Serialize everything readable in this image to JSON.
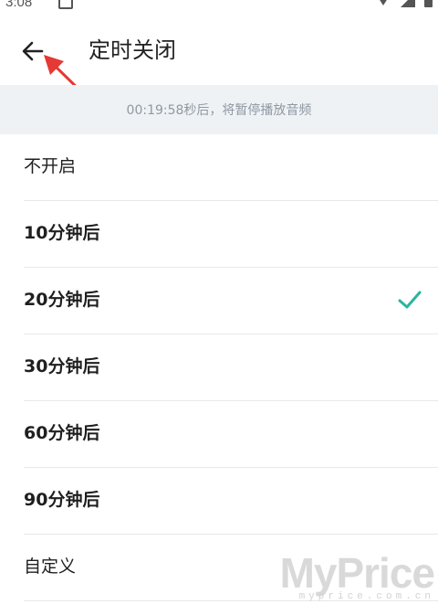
{
  "status_bar": {
    "time": "3:08",
    "icons": [
      "notification-icon",
      "wifi-icon",
      "signal-icon",
      "battery-icon"
    ]
  },
  "header": {
    "back_icon": "arrow-left-icon",
    "title": "定时关闭"
  },
  "banner": {
    "text": "00:19:58秒后，将暂停播放音频"
  },
  "options": [
    {
      "label": "不开启",
      "selected": false
    },
    {
      "label": "10分钟后",
      "selected": false
    },
    {
      "label": "20分钟后",
      "selected": true
    },
    {
      "label": "30分钟后",
      "selected": false
    },
    {
      "label": "60分钟后",
      "selected": false
    },
    {
      "label": "90分钟后",
      "selected": false
    },
    {
      "label": "自定义",
      "selected": false
    }
  ],
  "watermark": {
    "logo": "MyPrice",
    "url": "myprice.com.cn"
  },
  "colors": {
    "accent_check": "#2bb5a0",
    "annotation_arrow": "#e53935",
    "banner_background": "#eef2f5",
    "banner_text": "#8f98a2"
  }
}
